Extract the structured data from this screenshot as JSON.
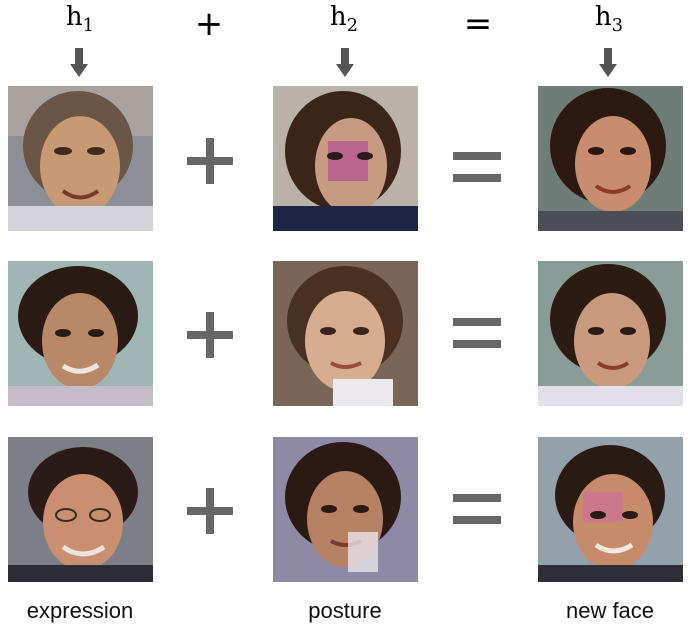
{
  "headers": {
    "h1": {
      "base": "h",
      "sub": "1"
    },
    "h2": {
      "base": "h",
      "sub": "2"
    },
    "h3": {
      "base": "h",
      "sub": "3"
    },
    "plus_symbol": "+",
    "equals_symbol": "="
  },
  "captions": {
    "col1": "expression",
    "col2": "posture",
    "col3": "new face"
  },
  "icons": {
    "arrow": "down-arrow-icon",
    "plus": "plus-icon",
    "equals": "equals-icon"
  },
  "colors": {
    "symbol_gray": "#666666",
    "arrow_gray": "#555555"
  }
}
